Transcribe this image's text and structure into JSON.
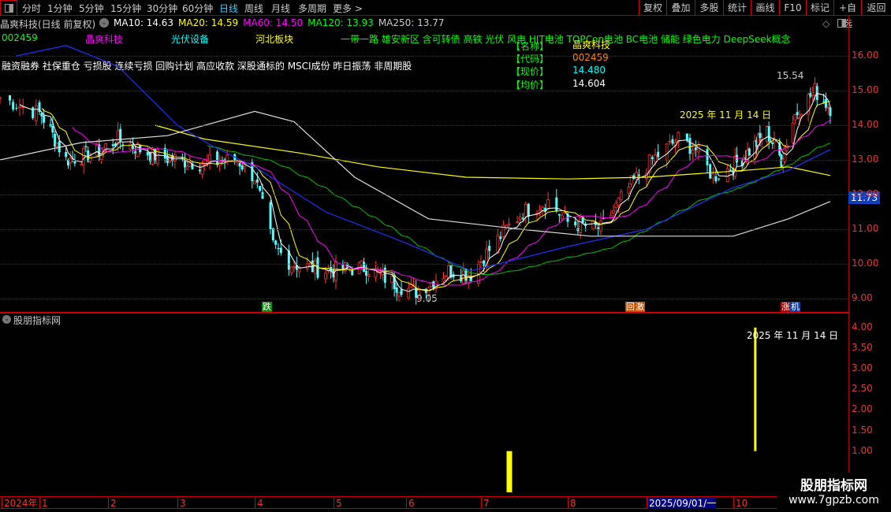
{
  "nav": {
    "periods": [
      "分时",
      "1分钟",
      "5分钟",
      "15分钟",
      "30分钟",
      "60分钟",
      "日线",
      "周线",
      "月线",
      "多周期",
      "更多 >"
    ],
    "active_period": "日线",
    "buttons": [
      "复权",
      "叠加",
      "多股",
      "统计",
      "画线",
      "F10",
      "标记",
      "+自选",
      "返回"
    ]
  },
  "header": {
    "title": "晶爽科技(日线 前复权)",
    "ma": [
      {
        "label": "MA10: 14.63",
        "color": "#ffffff"
      },
      {
        "label": "MA20: 14.59",
        "color": "#ffff00"
      },
      {
        "label": "MA60: 14.50",
        "color": "#ff00ff"
      },
      {
        "label": "MA120: 13.93",
        "color": "#00ff00"
      },
      {
        "label": "MA250: 13.77",
        "color": "#cccccc"
      }
    ]
  },
  "tags": {
    "code": "002459",
    "name": "晶爽科技",
    "industry": "光伏设备",
    "region": "河北板块",
    "concepts": "一带一路 雄安新区 含可转债 高铁 光伏 风电 HJT电池 TOPCon电池 BC电池 储能 绿色电力 DeepSeek概念",
    "features": "融资融券 社保重仓 亏损股 连续亏损 回购计划 高应收款 深股通标的 MSCI成份 昨日振荡 非周期股"
  },
  "info": {
    "name_label": "【名称】",
    "name": "晶爽科技",
    "code_label": "【代码】",
    "code": "002459",
    "price_label": "【现价】",
    "price": "14.480",
    "avg_label": "【均价】",
    "avg": "14.604"
  },
  "annotations": {
    "date_main": "2025 年 11 月 14 日",
    "high": "15.54",
    "low": "9.05",
    "date_sub": "2025 年 11 月 14 日",
    "current_price_tag": "11.73"
  },
  "signals": [
    {
      "text": "跌",
      "color": "#0a8a0a"
    },
    {
      "text": "回",
      "color": "#c05000"
    },
    {
      "text": "激",
      "color": "#c05000"
    },
    {
      "text": "涨",
      "color": "#a00000"
    },
    {
      "text": "机",
      "color": "#1040a0"
    }
  ],
  "sub_panel": {
    "title": "股朋指标网"
  },
  "watermark": {
    "line1": "股朋指标网",
    "line2": "www.7gpzb.com"
  },
  "xaxis": {
    "labels": [
      "2024年",
      "1",
      "2",
      "3",
      "4",
      "5",
      "6",
      "7",
      "8",
      "2025/09/01/一",
      "10"
    ]
  },
  "chart_data": [
    {
      "type": "candlestick",
      "yaxis_ticks": [
        "16.00",
        "15.00",
        "14.00",
        "13.00",
        "12.00",
        "11.00",
        "10.00",
        "9.00"
      ],
      "ylim": [
        8.8,
        16.2
      ],
      "grid": true,
      "close_path": [
        [
          "2024-12-20",
          14.8
        ],
        [
          "2025-01-02",
          14.3
        ],
        [
          "2025-01-13",
          13.0
        ],
        [
          "2025-01-27",
          13.2
        ],
        [
          "2025-02-05",
          13.6
        ],
        [
          "2025-02-20",
          13.1
        ],
        [
          "2025-03-10",
          12.9
        ],
        [
          "2025-03-25",
          13.0
        ],
        [
          "2025-04-01",
          12.5
        ],
        [
          "2025-04-08",
          10.5
        ],
        [
          "2025-04-15",
          10.0
        ],
        [
          "2025-04-28",
          9.8
        ],
        [
          "2025-05-15",
          9.9
        ],
        [
          "2025-05-28",
          9.4
        ],
        [
          "2025-06-05",
          9.2
        ],
        [
          "2025-06-18",
          9.8
        ],
        [
          "2025-06-27",
          9.7
        ],
        [
          "2025-07-10",
          11.0
        ],
        [
          "2025-07-16",
          11.5
        ],
        [
          "2025-07-25",
          11.8
        ],
        [
          "2025-08-01",
          11.2
        ],
        [
          "2025-08-14",
          11.0
        ],
        [
          "2025-08-26",
          12.3
        ],
        [
          "2025-09-03",
          13.0
        ],
        [
          "2025-09-12",
          13.6
        ],
        [
          "2025-09-18",
          13.3
        ],
        [
          "2025-09-24",
          12.5
        ],
        [
          "2025-10-09",
          13.2
        ],
        [
          "2025-10-20",
          13.8
        ],
        [
          "2025-10-28",
          13.0
        ],
        [
          "2025-11-04",
          14.3
        ],
        [
          "2025-11-13",
          15.0
        ],
        [
          "2025-11-20",
          14.5
        ]
      ],
      "long_lines": [
        {
          "color": "#ffff00",
          "points": [
            [
              "2025-02-20",
              14.0
            ],
            [
              "2025-03-12",
              13.6
            ],
            [
              "2025-04-18",
              13.2
            ],
            [
              "2025-05-20",
              12.8
            ],
            [
              "2025-06-25",
              12.5
            ],
            [
              "2025-08-01",
              12.45
            ],
            [
              "2025-09-01",
              12.5
            ],
            [
              "2025-10-08",
              12.7
            ],
            [
              "2025-11-01",
              12.8
            ],
            [
              "2025-11-20",
              12.55
            ]
          ]
        },
        {
          "color": "#2030ff",
          "points": [
            [
              "2024-12-25",
              16.0
            ],
            [
              "2025-01-13",
              16.3
            ],
            [
              "2025-02-05",
              15.7
            ],
            [
              "2025-03-01",
              14.0
            ],
            [
              "2025-03-15",
              13.4
            ],
            [
              "2025-04-01",
              12.8
            ],
            [
              "2025-04-28",
              11.5
            ],
            [
              "2025-06-01",
              10.6
            ],
            [
              "2025-06-27",
              9.8
            ],
            [
              "2025-08-01",
              10.5
            ],
            [
              "2025-09-01",
              11.0
            ],
            [
              "2025-10-01",
              12.2
            ],
            [
              "2025-11-01",
              12.7
            ],
            [
              "2025-11-20",
              13.3
            ]
          ]
        },
        {
          "color": "#dddddd",
          "points": [
            [
              "2024-12-20",
              13.0
            ],
            [
              "2025-01-20",
              13.5
            ],
            [
              "2025-02-25",
              13.7
            ],
            [
              "2025-04-01",
              14.4
            ],
            [
              "2025-04-16",
              14.1
            ],
            [
              "2025-05-10",
              12.5
            ],
            [
              "2025-06-10",
              11.3
            ],
            [
              "2025-07-15",
              11.0
            ],
            [
              "2025-08-10",
              10.8
            ],
            [
              "2025-10-01",
              10.8
            ],
            [
              "2025-11-01",
              11.3
            ],
            [
              "2025-11-20",
              11.8
            ]
          ]
        }
      ]
    },
    {
      "type": "bar",
      "yaxis_ticks": [
        "4.00",
        "3.50",
        "3.00",
        "2.50",
        "2.00",
        "1.50",
        "1.00"
      ],
      "ylim": [
        0,
        4.2
      ],
      "bars": [
        {
          "date": "2025-07-11",
          "from": 0,
          "to": 1.0,
          "color": "#ffff00"
        },
        {
          "date": "2025-10-14",
          "from": 1.0,
          "to": 4.0,
          "color": "#ffff00"
        }
      ]
    }
  ]
}
